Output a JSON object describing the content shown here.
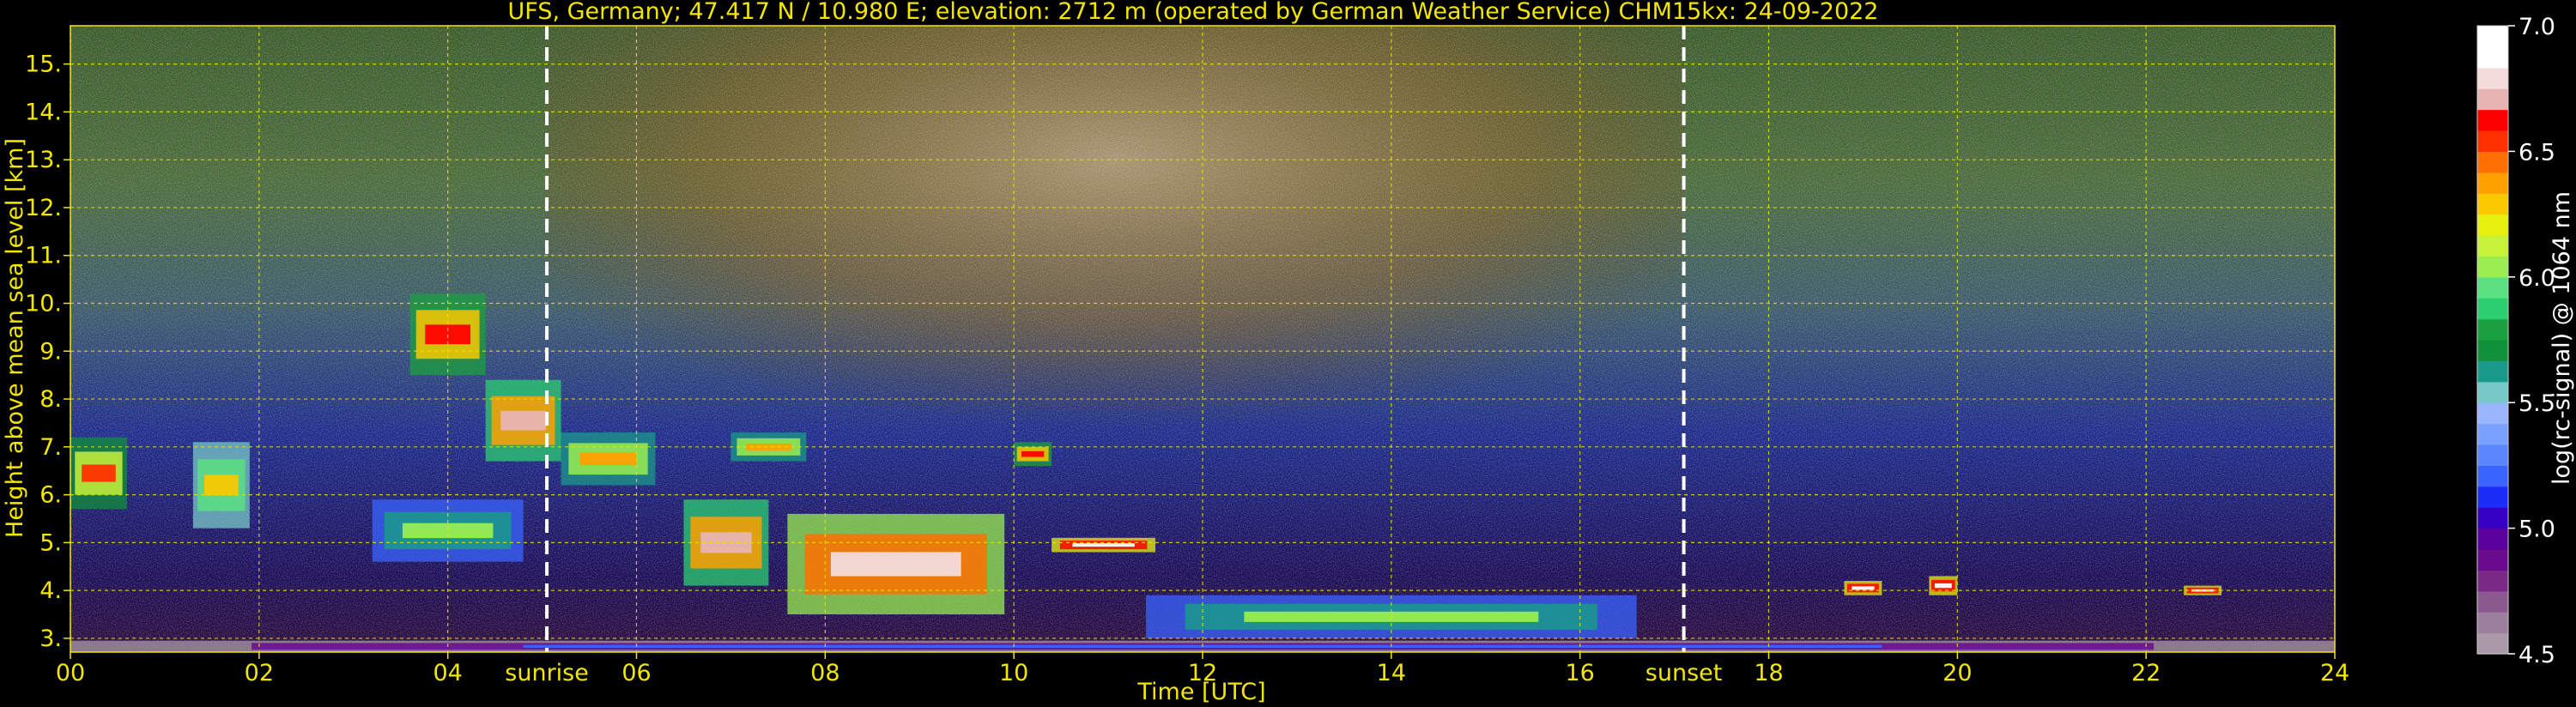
{
  "chart_data": {
    "type": "heatmap",
    "title": "UFS, Germany; 47.417 N / 10.980 E; elevation: 2712 m  (operated by German Weather Service)    CHM15kx: 24-09-2022",
    "xlabel": "Time [UTC]",
    "ylabel": "Height above mean sea level [km]",
    "xlim": [
      0,
      24
    ],
    "ylim": [
      2.712,
      15.8
    ],
    "x_ticks": [
      "00",
      "02",
      "04",
      "06",
      "08",
      "10",
      "12",
      "14",
      "16",
      "18",
      "20",
      "22",
      "24"
    ],
    "y_ticks": [
      "3.",
      "4.",
      "5.",
      "6.",
      "7.",
      "8.",
      "9.",
      "10.",
      "11.",
      "12.",
      "13.",
      "14.",
      "15."
    ],
    "grid": true,
    "colorbar": {
      "label": "log(rc-signal) @ 1064 nm",
      "range": [
        4.5,
        7.0
      ],
      "ticks": [
        "4.5",
        "5.0",
        "5.5",
        "6.0",
        "6.5",
        "7.0"
      ],
      "colors": [
        "#aa9aa8",
        "#9b7f9c",
        "#8a5a8e",
        "#7a2a86",
        "#6a0a8c",
        "#5a009c",
        "#3500c2",
        "#1a2cf5",
        "#3a64ff",
        "#5a86ff",
        "#7aa0ff",
        "#9ab4ff",
        "#78c8c8",
        "#1a9a8a",
        "#10903a",
        "#1aa040",
        "#2ccf70",
        "#5ae080",
        "#9aee50",
        "#c8f23a",
        "#e8f010",
        "#f8c800",
        "#ffa000",
        "#ff7000",
        "#ff3000",
        "#ff0000",
        "#e8b4b4",
        "#f4dcdc",
        "#ffffff",
        "#ffffff"
      ]
    },
    "annotations": [
      {
        "label": "sunrise",
        "x": 5.05
      },
      {
        "label": "sunset",
        "x": 17.1
      }
    ],
    "features": [
      {
        "t0": 0.0,
        "t1": 0.6,
        "h0": 5.7,
        "h1": 7.2,
        "level": 6.5
      },
      {
        "t0": 1.3,
        "t1": 1.9,
        "h0": 5.3,
        "h1": 7.1,
        "level": 6.3
      },
      {
        "t0": 3.2,
        "t1": 4.8,
        "h0": 4.6,
        "h1": 5.9,
        "level": 6.0
      },
      {
        "t0": 3.6,
        "t1": 4.4,
        "h0": 8.5,
        "h1": 10.2,
        "level": 6.6
      },
      {
        "t0": 4.4,
        "t1": 5.2,
        "h0": 6.7,
        "h1": 8.4,
        "level": 6.7
      },
      {
        "t0": 5.2,
        "t1": 6.2,
        "h0": 6.2,
        "h1": 7.3,
        "level": 6.4
      },
      {
        "t0": 6.5,
        "t1": 7.4,
        "h0": 4.1,
        "h1": 5.9,
        "level": 6.7
      },
      {
        "t0": 7.6,
        "t1": 9.9,
        "h0": 3.5,
        "h1": 5.6,
        "level": 6.8
      },
      {
        "t0": 7.0,
        "t1": 7.8,
        "h0": 6.7,
        "h1": 7.3,
        "level": 6.4
      },
      {
        "t0": 10.0,
        "t1": 10.4,
        "h0": 6.6,
        "h1": 7.1,
        "level": 6.6
      },
      {
        "t0": 10.4,
        "t1": 11.5,
        "h0": 4.8,
        "h1": 5.1,
        "level": 7.0
      },
      {
        "t0": 11.4,
        "t1": 16.6,
        "h0": 3.0,
        "h1": 3.9,
        "level": 6.0
      },
      {
        "t0": 18.8,
        "t1": 19.2,
        "h0": 3.9,
        "h1": 4.2,
        "level": 7.0
      },
      {
        "t0": 19.7,
        "t1": 20.0,
        "h0": 3.9,
        "h1": 4.3,
        "level": 7.0
      },
      {
        "t0": 22.4,
        "t1": 22.8,
        "h0": 3.9,
        "h1": 4.1,
        "level": 7.0
      },
      {
        "t0": 0.0,
        "t1": 24.0,
        "h0": 2.712,
        "h1": 2.95,
        "level": 5.2
      }
    ]
  }
}
